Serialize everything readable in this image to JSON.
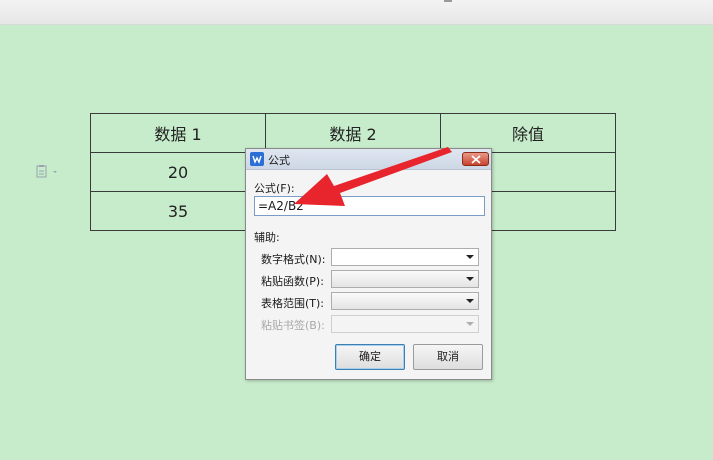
{
  "table": {
    "rows": [
      [
        "数据 1",
        "数据 2",
        "除值"
      ],
      [
        "20",
        "",
        ""
      ],
      [
        "35",
        "",
        ""
      ]
    ]
  },
  "dialog": {
    "title": "公式",
    "formula_label": "公式(F):",
    "formula_value": "=A2/B2",
    "aux_label": "辅助:",
    "number_format_label": "数字格式(N):",
    "paste_function_label": "粘贴函数(P):",
    "table_range_label": "表格范围(T):",
    "paste_bookmark_label": "粘贴书签(B):",
    "ok_label": "确定",
    "cancel_label": "取消"
  },
  "colors": {
    "background": "#c7eccb",
    "annotation_arrow": "#e8242c",
    "app_icon": "#2b6fd6"
  },
  "icons": {
    "paste_options": "paste-options-icon",
    "app": "wps-writer-icon",
    "close": "close-icon",
    "dropdown": "chevron-down-icon"
  }
}
